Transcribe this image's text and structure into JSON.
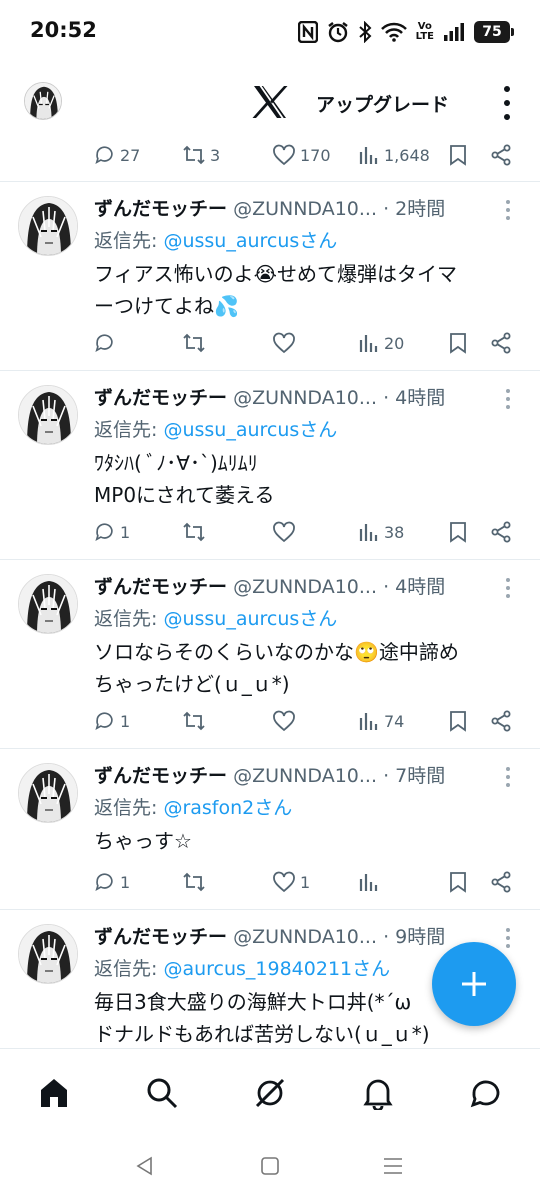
{
  "status_bar": {
    "time": "20:52",
    "battery": "75",
    "network": "VoLTE"
  },
  "header": {
    "upgrade_label": "アップグレード",
    "logo_icon": "x-logo-icon"
  },
  "previous_tweet_actions": {
    "replies": "27",
    "reposts": "3",
    "likes": "170",
    "views": "1,648"
  },
  "tweets": [
    {
      "name": "ずんだモッチー",
      "handle": "@ZUNNDA10...",
      "time": "· 2時間",
      "reply_prefix": "返信先: ",
      "reply_to": "@ussu_aurcusさん",
      "lines": [
        "フィアス怖いのよ😭せめて爆弾はタイマ",
        "ーつけてよね💦"
      ],
      "replies": "",
      "reposts": "",
      "likes": "",
      "views": "20"
    },
    {
      "name": "ずんだモッチー",
      "handle": "@ZUNNDA10...",
      "time": "· 4時間",
      "reply_prefix": "返信先: ",
      "reply_to": "@ussu_aurcusさん",
      "lines": [
        "ﾜﾀｼﾊ( ﾞﾉ･∀･`)ﾑﾘﾑﾘ",
        "MP0にされて萎える"
      ],
      "replies": "1",
      "reposts": "",
      "likes": "",
      "views": "38"
    },
    {
      "name": "ずんだモッチー",
      "handle": "@ZUNNDA10...",
      "time": "· 4時間",
      "reply_prefix": "返信先: ",
      "reply_to": "@ussu_aurcusさん",
      "lines": [
        "ソロならそのくらいなのかな🙄途中諦め",
        "ちゃったけど(ｕ_ｕ*)"
      ],
      "replies": "1",
      "reposts": "",
      "likes": "",
      "views": "74"
    },
    {
      "name": "ずんだモッチー",
      "handle": "@ZUNNDA10...",
      "time": "· 7時間",
      "reply_prefix": "返信先: ",
      "reply_to": "@rasfon2さん",
      "lines": [
        "ちゃっす☆"
      ],
      "replies": "1",
      "reposts": "",
      "likes": "1",
      "views": ""
    },
    {
      "name": "ずんだモッチー",
      "handle": "@ZUNNDA10...",
      "time": "· 9時間",
      "reply_prefix": "返信先: ",
      "reply_to": "@aurcus_19840211さん",
      "lines": [
        "毎日3食大盛りの海鮮大トロ丼(*´ω",
        "ドナルドもあれば苦労しない(ｕ_ｕ*)"
      ],
      "replies": "",
      "reposts": "",
      "likes": "",
      "views": ""
    }
  ],
  "fab": {
    "icon": "plus-icon",
    "color": "#1d9bf0"
  },
  "bottom_nav": [
    "home-icon",
    "search-icon",
    "grok-icon",
    "notifications-icon",
    "messages-icon"
  ],
  "system_nav": [
    "back-icon",
    "home-circle-icon",
    "recents-icon"
  ],
  "colors": {
    "accent": "#1d9bf0",
    "secondary_text": "#536471"
  }
}
